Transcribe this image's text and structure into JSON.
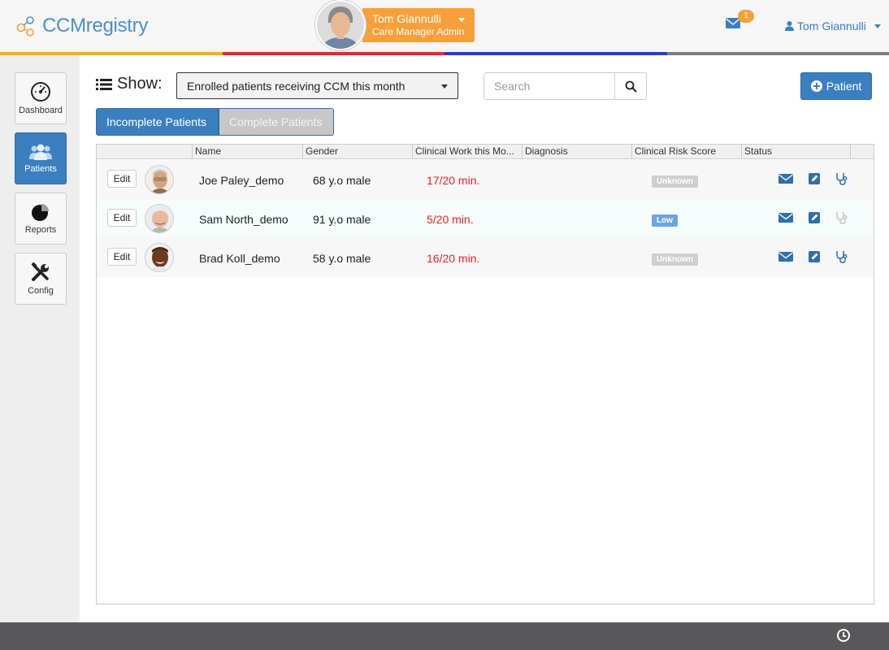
{
  "app": {
    "brand": "CCMregistry"
  },
  "header": {
    "user_name": "Tom Giannulli",
    "user_role": "Care Manager Admin",
    "notification_count": "1",
    "menu_user": "Tom Giannulli",
    "color_bar": [
      "#f2a93b",
      "#d7302b",
      "#2b3ec0",
      "#7d7d7d"
    ]
  },
  "sidebar": {
    "items": [
      {
        "label": "Dashboard",
        "icon": "speedometer-icon"
      },
      {
        "label": "Patients",
        "icon": "users-icon"
      },
      {
        "label": "Reports",
        "icon": "pie-chart-icon"
      },
      {
        "label": "Config",
        "icon": "tools-icon"
      }
    ]
  },
  "toolbar": {
    "show_label": "Show:",
    "filter_value": "Enrolled patients receiving CCM this month",
    "search_placeholder": "Search",
    "add_patient_label": "Patient"
  },
  "tabs": [
    {
      "label": "Incomplete Patients",
      "active": true
    },
    {
      "label": "Complete Patients",
      "active": false
    }
  ],
  "table": {
    "columns": [
      "Name",
      "Gender",
      "Clinical Work this Mo...",
      "Diagnosis",
      "Clinical Risk Score",
      "Status"
    ],
    "edit_label": "Edit",
    "rows": [
      {
        "name": "Joe Paley_demo",
        "gender": "68 y.o male",
        "work": "17/20 min.",
        "diagnosis": "",
        "risk": "Unknown"
      },
      {
        "name": "Sam North_demo",
        "gender": "91 y.o male",
        "work": "5/20 min.",
        "diagnosis": "",
        "risk": "Low"
      },
      {
        "name": "Brad Koll_demo",
        "gender": "58 y.o male",
        "work": "16/20 min.",
        "diagnosis": "",
        "risk": "Unknown"
      }
    ]
  },
  "colors": {
    "accent": "#3a7fc0",
    "orange": "#f5a03a",
    "danger": "#e02424"
  }
}
